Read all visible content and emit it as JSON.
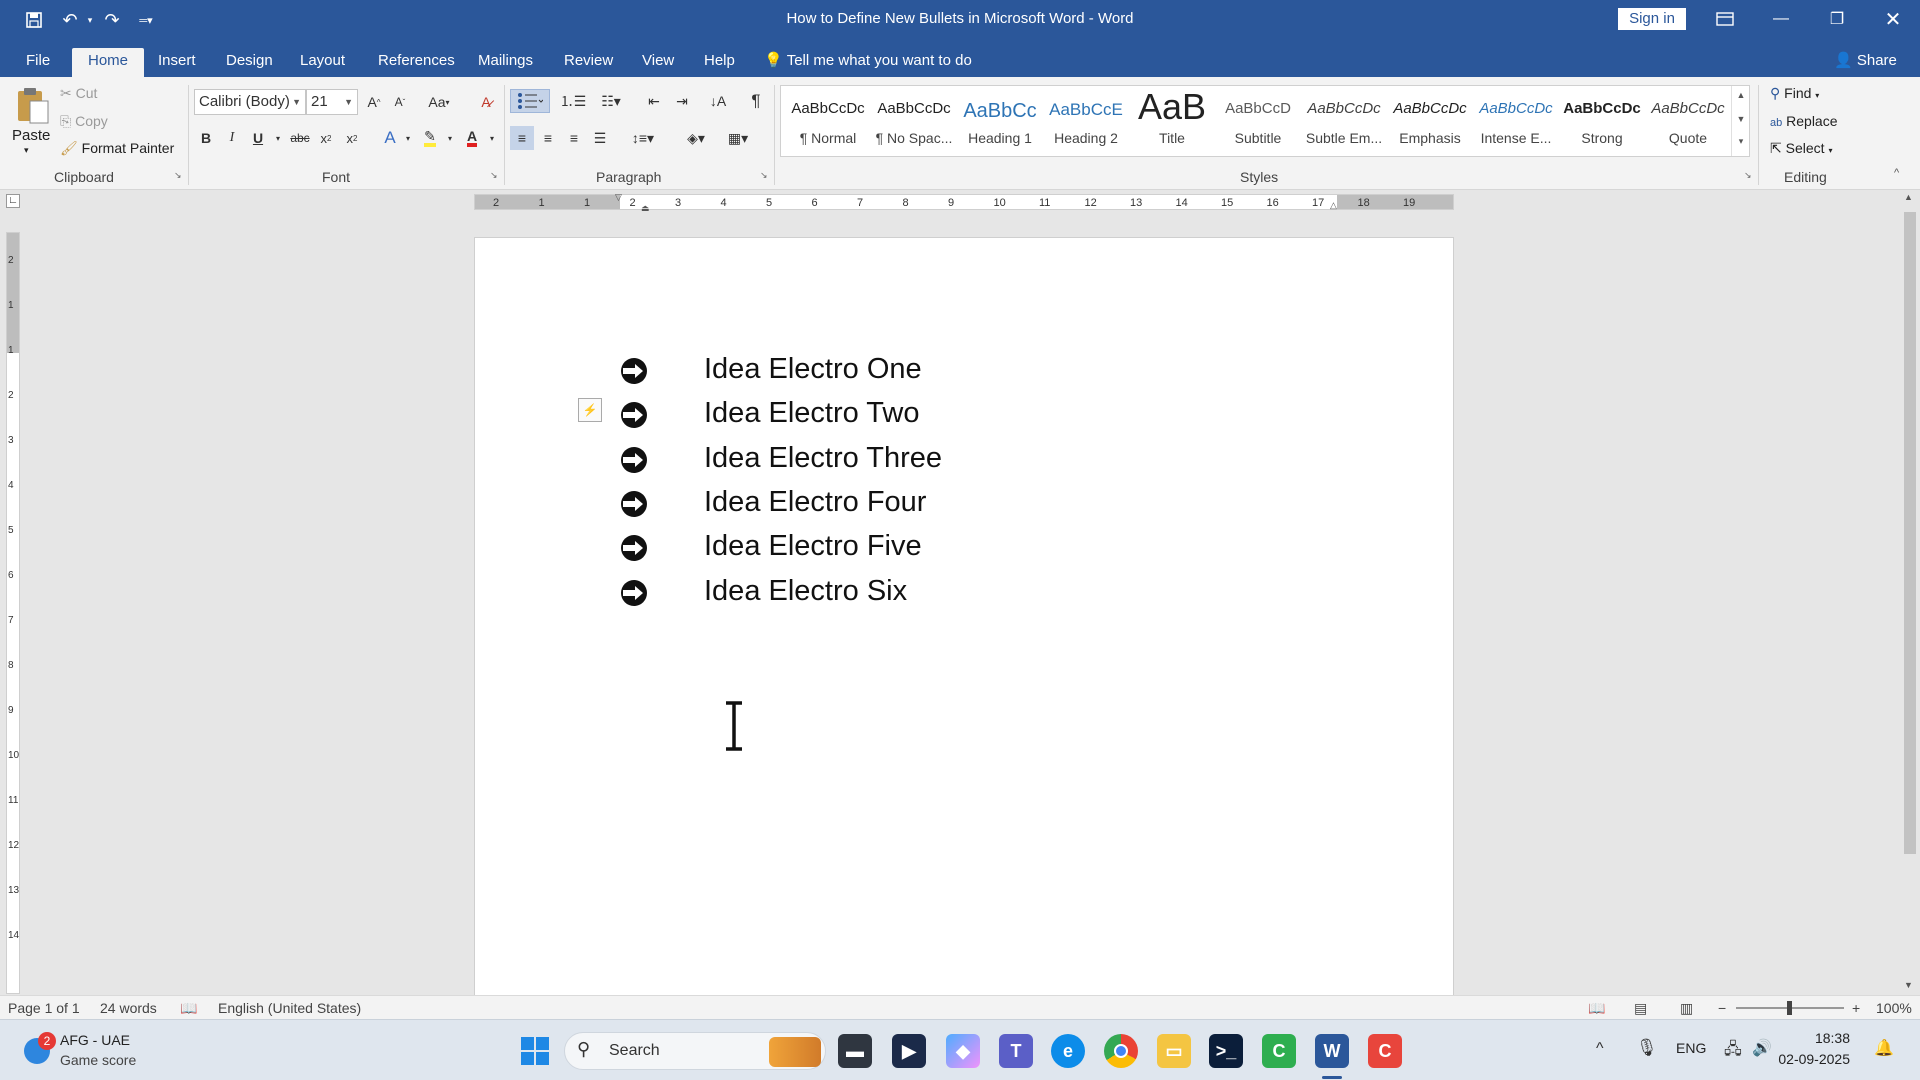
{
  "window": {
    "title": "How to Define New Bullets in Microsoft Word  -  Word",
    "sign_in": "Sign in",
    "quick_access": [
      "save-icon",
      "undo-icon",
      "redo-icon",
      "customize-icon"
    ]
  },
  "tabs": {
    "file": "File",
    "home": "Home",
    "insert": "Insert",
    "design": "Design",
    "layout": "Layout",
    "references": "References",
    "mailings": "Mailings",
    "review": "Review",
    "view": "View",
    "help": "Help",
    "tell_me": "Tell me what you want to do",
    "share": "Share"
  },
  "ribbon": {
    "clipboard": {
      "label": "Clipboard",
      "paste": "Paste",
      "cut": "Cut",
      "copy": "Copy",
      "format_painter": "Format Painter"
    },
    "font": {
      "label": "Font",
      "name": "Calibri (Body)",
      "size": "21",
      "change_case": "Aa"
    },
    "paragraph": {
      "label": "Paragraph"
    },
    "styles": {
      "label": "Styles",
      "items": [
        {
          "preview": "AaBbCcDc",
          "name": "¶ Normal"
        },
        {
          "preview": "AaBbCcDc",
          "name": "¶ No Spac..."
        },
        {
          "preview": "AaBbCc",
          "name": "Heading 1"
        },
        {
          "preview": "AaBbCcE",
          "name": "Heading 2"
        },
        {
          "preview": "AaB",
          "name": "Title"
        },
        {
          "preview": "AaBbCcD",
          "name": "Subtitle"
        },
        {
          "preview": "AaBbCcDc",
          "name": "Subtle Em..."
        },
        {
          "preview": "AaBbCcDc",
          "name": "Emphasis"
        },
        {
          "preview": "AaBbCcDc",
          "name": "Intense E..."
        },
        {
          "preview": "AaBbCcDc",
          "name": "Strong"
        },
        {
          "preview": "AaBbCcDc",
          "name": "Quote"
        }
      ]
    },
    "editing": {
      "label": "Editing",
      "find": "Find",
      "replace": "Replace",
      "select": "Select"
    }
  },
  "ruler": {
    "ticks": [
      "2",
      "1",
      "1",
      "2",
      "3",
      "4",
      "5",
      "6",
      "7",
      "8",
      "9",
      "10",
      "11",
      "12",
      "13",
      "14",
      "15",
      "16",
      "17",
      "18",
      "19"
    ],
    "vticks": [
      "2",
      "1",
      "1",
      "2",
      "3",
      "4",
      "5",
      "6",
      "7",
      "8",
      "9",
      "10",
      "11",
      "12",
      "13",
      "14"
    ]
  },
  "document": {
    "bullets": [
      "Idea Electro One",
      "Idea Electro Two",
      "Idea Electro Three",
      "Idea Electro Four",
      "Idea Electro Five",
      "Idea Electro Six"
    ]
  },
  "status": {
    "page": "Page 1 of 1",
    "words": "24 words",
    "language": "English (United States)",
    "zoom": "100%"
  },
  "taskbar": {
    "weather_badge": "2",
    "weather_title": "AFG - UAE",
    "weather_sub": "Game score",
    "search": "Search",
    "lang": "ENG",
    "time": "18:38",
    "date": "02-09-2025"
  },
  "colors": {
    "accent": "#2b579a",
    "ribbon_bg": "#f3f3f3",
    "canvas_bg": "#e6e6e6"
  }
}
